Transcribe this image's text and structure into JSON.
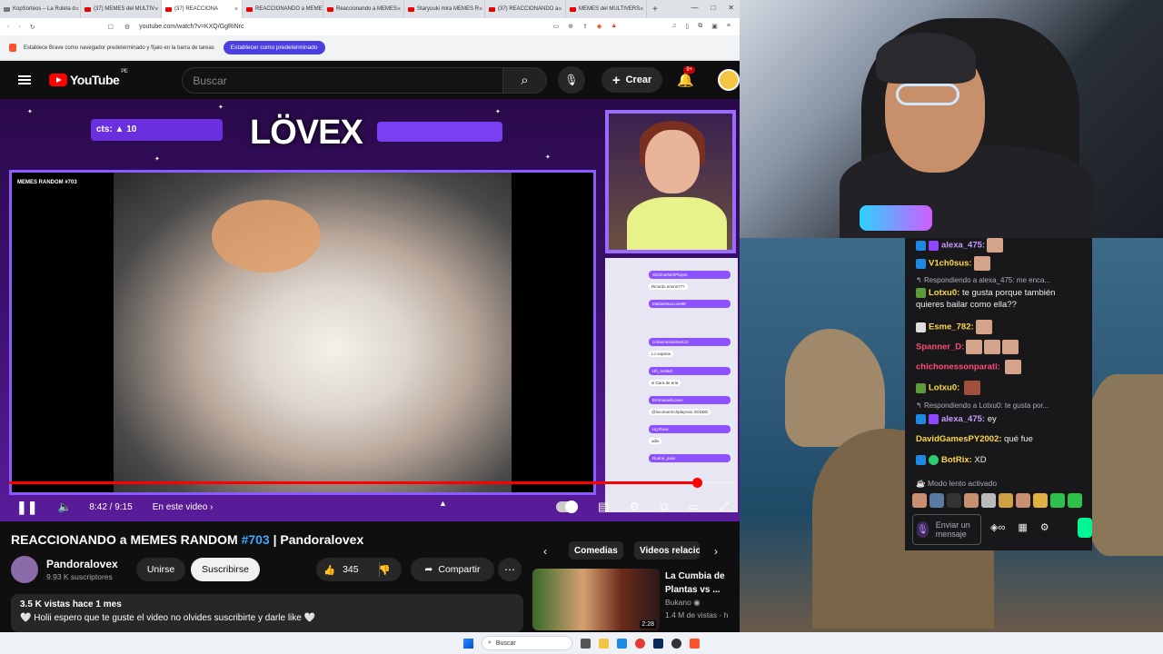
{
  "browser": {
    "tabs": [
      {
        "label": "KopSorteos – La Ruleta d"
      },
      {
        "label": "(37) MEMES del MULTIV"
      },
      {
        "label": "(37) REACCIONA"
      },
      {
        "label": "REACCIONANDO a MEME"
      },
      {
        "label": "Reaccionando a MEMES"
      },
      {
        "label": "Staryuuki mira MEMES R"
      },
      {
        "label": "(37) REACCIONANDO a"
      },
      {
        "label": "MEMES del MULTIVERS"
      }
    ],
    "url": "youtube.com/watch?v=KXQ/GgRiNrc",
    "brave_bar_text": "Establece Brave como navegador predeterminado y fíjalo en la barra de tareas",
    "brave_bar_button": "Establecer como predeterminado"
  },
  "youtube": {
    "logo": "YouTube",
    "region": "PE",
    "search_placeholder": "Buscar",
    "create_label": "Crear",
    "notifications_badge": "9+"
  },
  "video": {
    "counter_text": "cts: ▲ 10",
    "brand_logo": "LÖVEX",
    "meme_label": "MEMES RANDOM #703",
    "time": "8:42 / 9:15",
    "chapter": "En este video",
    "progress": 0.946,
    "chat_users": [
      "XbOmarMchPlayss",
      "MatiasMuxLove99",
      "comemealsotive113",
      "Hh_Avtakd",
      "EmmanuelLoves",
      "Hg:Rarw",
      "Ruano_pass"
    ],
    "chat_lines": [
      "Ricardo ennns???",
      "Lo superia",
      "si Cara de eria",
      "@lucomarmchplayssix XDDDD",
      "adis"
    ]
  },
  "video_info": {
    "title_prefix": "REACCIONANDO a MEMES RANDOM ",
    "title_hash": "#703",
    "title_suffix": " | Pandoralovex",
    "channel": "Pandoralovex",
    "subscribers": "9.93 K suscriptores",
    "join_label": "Unirse",
    "subscribe_label": "Suscribirse",
    "likes": "345",
    "share_label": "Compartir",
    "views": "3.5 K vistas",
    "age": "hace 1 mes",
    "description": "🤍 Holii espero que te guste el video no olvides suscribirte y darle like 🤍"
  },
  "recommendations": {
    "chips": [
      "Comedias",
      "Videos relacio"
    ],
    "item": {
      "title": "La Cumbia de Plantas vs ...",
      "channel": "Bukano",
      "meta": "1.4 M de vistas · h",
      "duration": "2:28"
    }
  },
  "twitch_chat": {
    "messages": [
      {
        "user": "alexa_475:",
        "color": "#c59bff",
        "text": ""
      },
      {
        "user": "V1ch0sus:",
        "color": "#ffd84a",
        "text": ""
      },
      {
        "reply": "Respondiendo a alexa_475: me enca..."
      },
      {
        "user": "Lotxu0:",
        "color": "#ffd84a",
        "text": "te gusta porque también quieres bailar como ella??"
      },
      {
        "user": "Esme_782:",
        "color": "#ffd84a",
        "text": ""
      },
      {
        "user": "Spanner_D:",
        "color": "#ff4d7a",
        "text": ""
      },
      {
        "user": "chichonessonparati:",
        "color": "#ff4d7a",
        "text": ""
      },
      {
        "user": "Lotxu0:",
        "color": "#ffd84a",
        "text": ""
      },
      {
        "reply": "Respondiendo a Lotxu0: te gusta por..."
      },
      {
        "user": "alexa_475:",
        "color": "#c59bff",
        "text": "ey"
      },
      {
        "user": "DavidGamesPY2002:",
        "color": "#ffd84a",
        "text": "qué fue"
      },
      {
        "user": "BotRix:",
        "color": "#ffd84a",
        "text": "XD"
      }
    ],
    "slow_mode": "Modo lento activado",
    "input_placeholder": "Enviar un mensaje"
  },
  "taskbar": {
    "search_placeholder": "Buscar"
  }
}
